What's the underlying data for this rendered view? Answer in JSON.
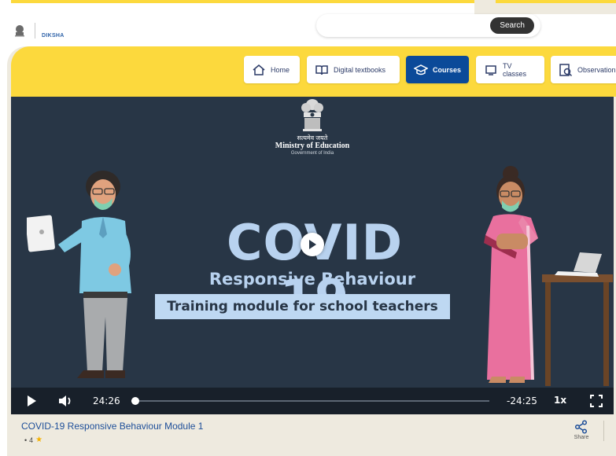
{
  "header": {
    "logo_label": "DIKSHA",
    "search": {
      "placeholder": "",
      "button_label": "Search"
    }
  },
  "nav": {
    "items": [
      {
        "label": "Home",
        "icon": "home-icon",
        "active": false
      },
      {
        "label": "Digital textbooks",
        "icon": "book-icon",
        "active": false
      },
      {
        "label": "Courses",
        "icon": "graduation-cap-icon",
        "active": true
      },
      {
        "label": "TV classes",
        "icon": "tv-icon",
        "active": false
      },
      {
        "label": "Observation",
        "icon": "observation-icon",
        "active": false
      }
    ]
  },
  "video": {
    "motto": "सत्यमेव जयते",
    "ministry": "Ministry of Education",
    "government": "Government of India",
    "title_main": "COVID 19",
    "subtitle": "Responsive Behaviour",
    "training": "Training module for school teachers",
    "controls": {
      "current_time": "24:26",
      "remaining_time": "-24:25",
      "speed": "1x",
      "progress_fraction": 0.01
    }
  },
  "content": {
    "title": "COVID-19 Responsive Behaviour Module 1",
    "meta_prefix": "•",
    "rating": "4",
    "share_label": "Share"
  },
  "colors": {
    "brand_yellow": "#fcd93d",
    "nav_active": "#0b4a99",
    "video_bg": "#283646",
    "title_text": "#b8d2ef",
    "link_blue": "#1d4e99"
  }
}
